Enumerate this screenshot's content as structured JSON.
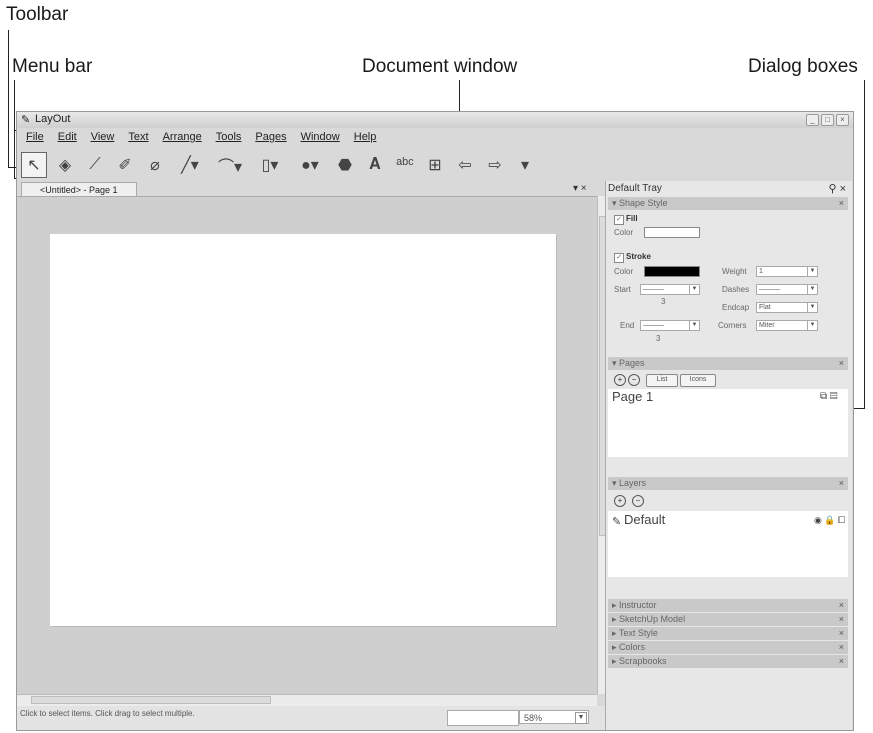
{
  "callouts": {
    "toolbar": "Toolbar",
    "menu_bar": "Menu bar",
    "document_window": "Document window",
    "dialog_boxes": "Dialog boxes"
  },
  "window": {
    "title": "LayOut",
    "menu": [
      "File",
      "Edit",
      "View",
      "Text",
      "Arrange",
      "Tools",
      "Pages",
      "Window",
      "Help"
    ],
    "doc_tab": "<Untitled> - Page 1",
    "status_message": "Click to select items. Click drag to select multiple.",
    "zoom": "58%"
  },
  "tray": {
    "title": "Default Tray",
    "shape_style": {
      "header": "Shape Style",
      "fill_label": "Fill",
      "color_label": "Color",
      "stroke_label": "Stroke",
      "weight_label": "Weight",
      "weight_value": "1",
      "start_label": "Start",
      "dashes_label": "Dashes",
      "endcap_label": "Endcap",
      "endcap_value": "Flat",
      "end_label": "End",
      "corners_label": "Corners",
      "corners_value": "Miter",
      "start_scale": "3",
      "end_scale": "3",
      "stroke_color": "#000000"
    },
    "pages": {
      "header": "Pages",
      "list_btn": "List",
      "icons_btn": "Icons",
      "page_name": "Page 1"
    },
    "layers": {
      "header": "Layers",
      "layer_name": "Default"
    },
    "collapsed": [
      "Instructor",
      "SketchUp Model",
      "Text Style",
      "Colors",
      "Scrapbooks"
    ]
  }
}
